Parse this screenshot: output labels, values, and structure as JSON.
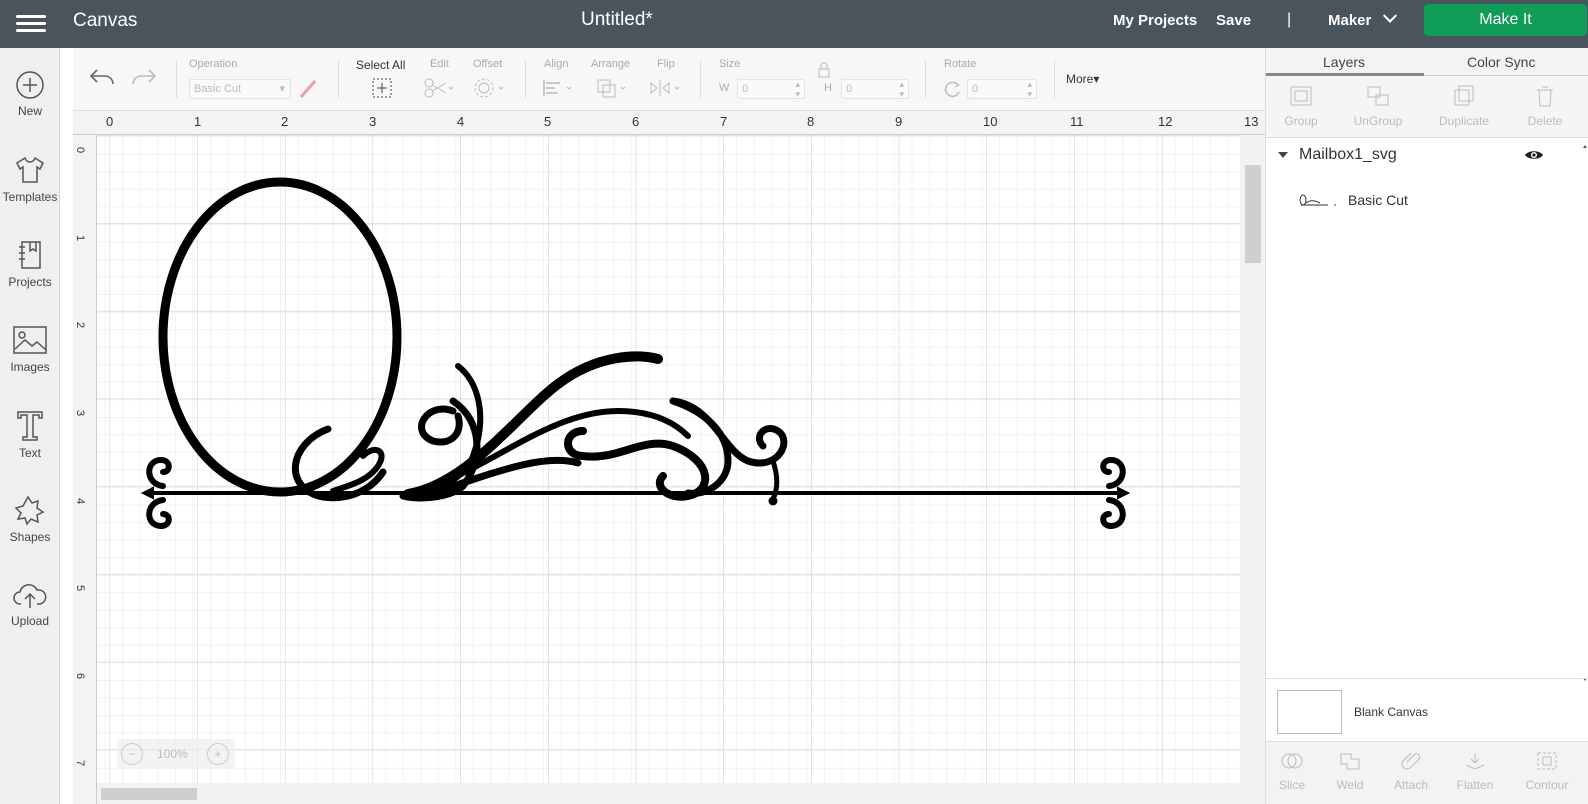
{
  "topbar": {
    "app_title": "Canvas",
    "doc_title": "Untitled*",
    "my_projects": "My Projects",
    "save": "Save",
    "separator": "|",
    "machine": "Maker",
    "make_it": "Make It"
  },
  "sidebar": {
    "items": [
      {
        "label": "New",
        "icon": "plus-circle-icon"
      },
      {
        "label": "Templates",
        "icon": "shirt-icon"
      },
      {
        "label": "Projects",
        "icon": "book-icon"
      },
      {
        "label": "Images",
        "icon": "image-icon"
      },
      {
        "label": "Text",
        "icon": "text-icon"
      },
      {
        "label": "Shapes",
        "icon": "shapes-icon"
      },
      {
        "label": "Upload",
        "icon": "upload-cloud-icon"
      }
    ]
  },
  "toolbar": {
    "operation_label": "Operation",
    "operation_value": "Basic Cut",
    "select_all": "Select All",
    "edit": "Edit",
    "offset": "Offset",
    "align": "Align",
    "arrange": "Arrange",
    "flip": "Flip",
    "size": "Size",
    "w_label": "W",
    "w_value": "0",
    "h_label": "H",
    "h_value": "0",
    "rotate": "Rotate",
    "rotate_value": "0",
    "more": "More"
  },
  "ruler": {
    "top": [
      "0",
      "1",
      "2",
      "3",
      "4",
      "5",
      "6",
      "7",
      "8",
      "9",
      "10",
      "11",
      "12",
      "13"
    ],
    "left": [
      "0",
      "1",
      "2",
      "3",
      "4",
      "5",
      "6",
      "7"
    ]
  },
  "zoom": {
    "minus": "−",
    "value": "100%",
    "plus": "+"
  },
  "panel": {
    "tabs": [
      "Layers",
      "Color Sync"
    ],
    "actions": [
      "Group",
      "UnGroup",
      "Duplicate",
      "Delete"
    ],
    "group_name": "Mailbox1_svg",
    "layer_name": "Basic Cut",
    "blank_canvas": "Blank Canvas",
    "bottom_actions": [
      "Slice",
      "Weld",
      "Attach",
      "Flatten",
      "Contour"
    ]
  },
  "colors": {
    "topbar": "#4a545c",
    "make_it": "#0f9d58",
    "design": "#000000"
  }
}
